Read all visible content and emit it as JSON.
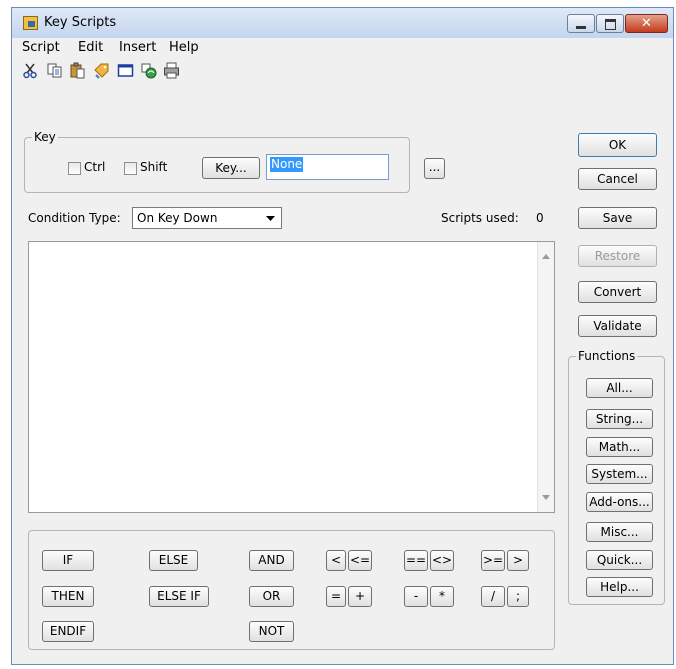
{
  "window": {
    "title": "Key Scripts"
  },
  "menu": [
    "Script",
    "Edit",
    "Insert",
    "Help"
  ],
  "toolbar_icons": [
    "scissors-icon",
    "copy-icon",
    "paste-icon",
    "tag-icon",
    "window-icon",
    "globe-icon",
    "print-icon"
  ],
  "key_group": {
    "legend": "Key",
    "ctrl_label": "Ctrl",
    "shift_label": "Shift",
    "key_button": "Key...",
    "key_value": "None",
    "browse_button": "..."
  },
  "condition": {
    "label": "Condition Type:",
    "value": "On Key Down"
  },
  "scripts_used": {
    "label": "Scripts used:",
    "count": "0"
  },
  "actions": {
    "ok": "OK",
    "cancel": "Cancel",
    "save": "Save",
    "restore": "Restore",
    "convert": "Convert",
    "validate": "Validate"
  },
  "functions": {
    "legend": "Functions",
    "buttons": [
      "All...",
      "String...",
      "Math...",
      "System...",
      "Add-ons...",
      "Misc...",
      "Quick...",
      "Help..."
    ]
  },
  "keywords": {
    "if": "IF",
    "then": "THEN",
    "endif": "ENDIF",
    "else": "ELSE",
    "elseif": "ELSE IF",
    "and": "AND",
    "or": "OR",
    "not": "NOT",
    "lt": "<",
    "le": "<=",
    "eq": "=",
    "plus": "+",
    "eqeq": "==",
    "ne": "<>",
    "minus": "-",
    "times": "*",
    "ge": ">=",
    "gt": ">",
    "div": "/",
    "semi": ";"
  }
}
